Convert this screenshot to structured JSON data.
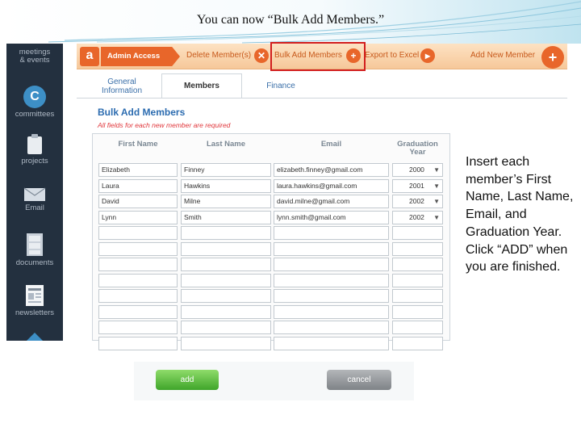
{
  "slide": {
    "title": "You can now “Bulk Add Members.”",
    "callout": "Insert each member’s First Name, Last Name, Email, and Graduation Year.  Click “ADD” when you are finished."
  },
  "sidebar": {
    "items": [
      {
        "label_line1": "meetings",
        "label_line2": "& events",
        "icon": "calendar-icon"
      },
      {
        "label": "committees",
        "icon_letter": "C",
        "icon": "committees-icon"
      },
      {
        "label": "projects",
        "icon": "clipboard-icon"
      },
      {
        "label": "Email",
        "icon": "envelope-icon"
      },
      {
        "label": "documents",
        "icon": "file-cabinet-icon"
      },
      {
        "label": "newsletters",
        "icon": "newspaper-icon"
      }
    ]
  },
  "actionbar": {
    "logo_letter": "a",
    "admin_access": "Admin Access",
    "delete_members": "Delete Member(s)",
    "bulk_add_members": "Bulk Add Members",
    "export_to_excel": "Export to Excel",
    "add_new_member": "Add New Member"
  },
  "tabs": {
    "general_information_line1": "General",
    "general_information_line2": "Information",
    "members": "Members",
    "finance": "Finance"
  },
  "panel": {
    "title": "Bulk Add Members",
    "note": "All fields for each new member are required"
  },
  "table": {
    "columns": [
      "First Name",
      "Last Name",
      "Email",
      "Graduation Year"
    ],
    "rows": [
      {
        "first": "Elizabeth",
        "last": "Finney",
        "email": "elizabeth.finney@gmail.com",
        "year": "2000"
      },
      {
        "first": "Laura",
        "last": "Hawkins",
        "email": "laura.hawkins@gmail.com",
        "year": "2001"
      },
      {
        "first": "David",
        "last": "Milne",
        "email": "david.milne@gmail.com",
        "year": "2002"
      },
      {
        "first": "Lynn",
        "last": "Smith",
        "email": "lynn.smith@gmail.com",
        "year": "2002"
      }
    ],
    "empty_row_count": 8
  },
  "buttons": {
    "add": "add",
    "cancel": "cancel"
  },
  "colors": {
    "accent_orange": "#e8662a",
    "highlight_red": "#d21f1f",
    "sidebar_bg": "#23303f",
    "link_blue": "#2c6cb0",
    "add_green": "#3fa52a"
  }
}
